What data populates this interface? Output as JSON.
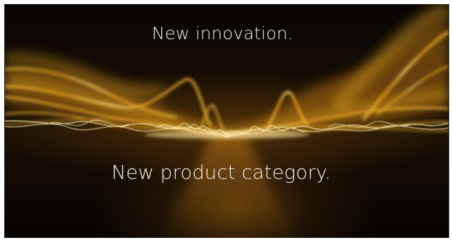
{
  "slide": {
    "headline_top": "New innovation.",
    "headline_bottom": "New product category."
  },
  "colors": {
    "background": "#120a04",
    "glow": "#f5b41e",
    "highlight": "#fff1b8",
    "text": "#f4f0ea"
  }
}
